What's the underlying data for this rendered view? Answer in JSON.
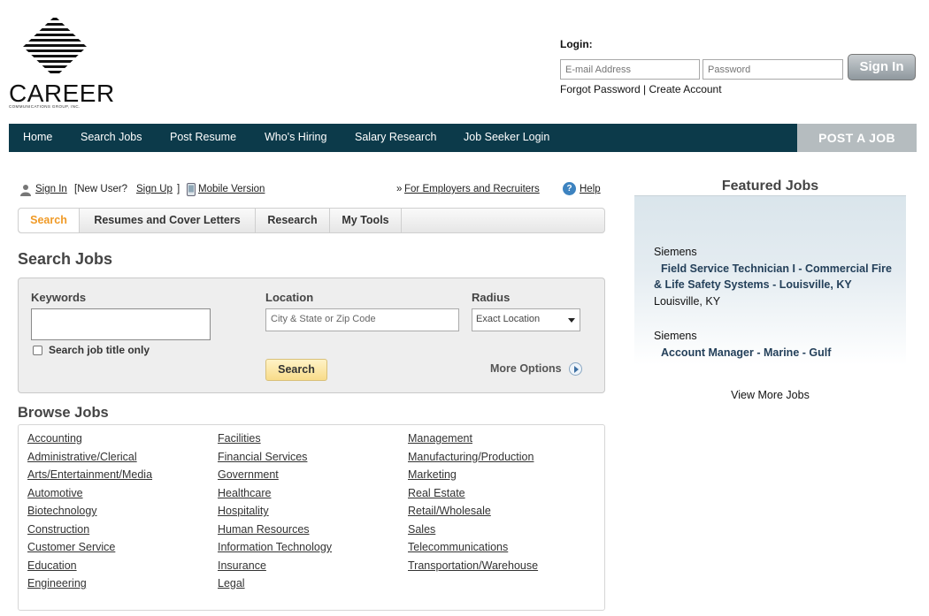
{
  "logo": {
    "wordmark": "CAREER",
    "subtitle": "COMMUNICATIONS GROUP, INC."
  },
  "login": {
    "title": "Login:",
    "email_placeholder": "E-mail Address",
    "password_placeholder": "Password",
    "signin_label": "Sign In",
    "forgot_label": "Forgot Password",
    "separator": "|",
    "create_label": "Create Account"
  },
  "nav": {
    "items": [
      "Home",
      "Search Jobs",
      "Post Resume",
      "Who's Hiring",
      "Salary Research",
      "Job Seeker Login"
    ],
    "post_job": "POST A JOB",
    "bg_color": "#0c3a4a"
  },
  "util": {
    "person_icon": "person-icon",
    "sign_in": "Sign In",
    "new_user_open": "[New User?",
    "sign_up": "Sign Up",
    "new_user_close": "]",
    "phone_icon": "mobile-phone-icon",
    "mobile": "Mobile Version",
    "employers_prefix": "»",
    "employers": "For Employers and Recruiters",
    "help_icon": "help-icon",
    "help": "Help"
  },
  "tabs": [
    "Search",
    "Resumes and Cover Letters",
    "Research",
    "My Tools"
  ],
  "search": {
    "title": "Search Jobs",
    "keywords_label": "Keywords",
    "keywords_value": "",
    "location_label": "Location",
    "location_placeholder": "City & State or Zip Code",
    "radius_label": "Radius",
    "radius_value": "Exact Location",
    "title_only_label": "Search job title only",
    "search_button": "Search",
    "more_options": "More Options"
  },
  "browse": {
    "title": "Browse Jobs",
    "col1": [
      "Accounting",
      "Administrative/Clerical",
      "Arts/Entertainment/Media",
      "Automotive",
      "Biotechnology",
      "Construction",
      "Customer Service",
      "Education",
      "Engineering"
    ],
    "col2": [
      "Facilities",
      "Financial Services",
      "Government",
      "Healthcare",
      "Hospitality",
      "Human Resources",
      "Information Technology",
      "Insurance",
      "Legal"
    ],
    "col3": [
      "Management",
      "Manufacturing/Production",
      "Marketing",
      "Real Estate",
      "Retail/Wholesale",
      "Sales",
      "Telecommunications",
      "Transportation/Warehouse"
    ]
  },
  "featured": {
    "title": "Featured Jobs",
    "jobs": [
      {
        "company": "Siemens",
        "title_line1": "Field Service Technician I - Commercial Fire",
        "title_line2": "& Life Safety Systems - Louisville, KY",
        "location": "Louisville, KY"
      },
      {
        "company": "Siemens",
        "title_line1": "Account Manager - Marine - Gulf"
      }
    ],
    "view_more": "View More Jobs"
  },
  "colors": {
    "active_tab": "#f09a26",
    "featured_link": "#24405a"
  }
}
